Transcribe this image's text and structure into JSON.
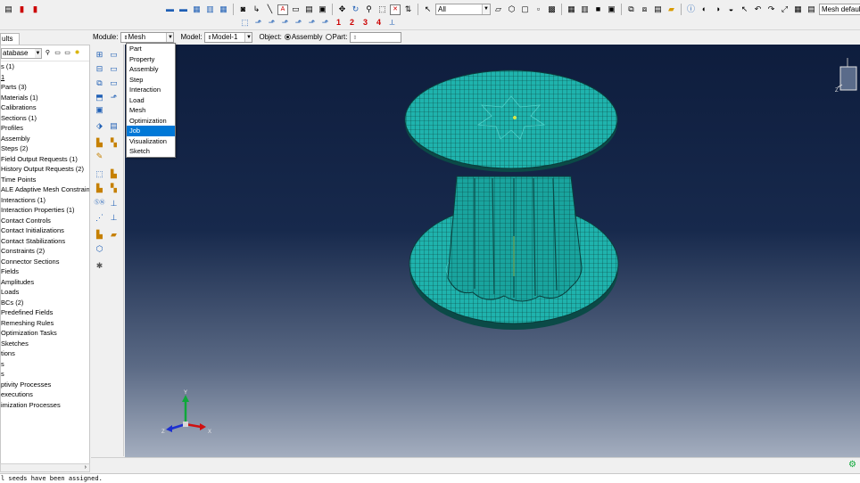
{
  "toolbar": {
    "numbers": [
      "1",
      "2",
      "3",
      "4"
    ],
    "selection_filter": "All",
    "render_style": "Mesh defaults"
  },
  "context": {
    "module_label": "Module:",
    "module_value": "Mesh",
    "model_label": "Model:",
    "model_value": "Model-1",
    "object_label": "Object:",
    "assembly_label": "Assembly",
    "part_label": "Part:"
  },
  "tree": {
    "tab_label": "ults",
    "filter_value": "atabase",
    "items": [
      "s (1)",
      "1",
      "Parts (3)",
      "Materials (1)",
      "Calibrations",
      "Sections (1)",
      "Profiles",
      "Assembly",
      "Steps (2)",
      "Field Output Requests (1)",
      "History Output Requests (2)",
      "Time Points",
      "ALE Adaptive Mesh Constraints",
      "Interactions (1)",
      "Interaction Properties (1)",
      "Contact Controls",
      "Contact Initializations",
      "Contact Stabilizations",
      "Constraints (2)",
      "Connector Sections",
      "Fields",
      "Amplitudes",
      "Loads",
      "BCs (2)",
      "Predefined Fields",
      "Remeshing Rules",
      "Optimization Tasks",
      "Sketches",
      "tions",
      "s",
      "s",
      "ptivity Processes",
      "executions",
      "imization Processes"
    ]
  },
  "module_menu": {
    "items": [
      "Part",
      "Property",
      "Assembly",
      "Step",
      "Interaction",
      "Load",
      "Mesh",
      "Optimization",
      "Job",
      "Visualization",
      "Sketch"
    ],
    "highlighted": "Job"
  },
  "triad": {
    "y": "Y",
    "z": "Z",
    "x": "X"
  },
  "mesh_color": "#1fb3ad",
  "message": "l seeds have been assigned."
}
